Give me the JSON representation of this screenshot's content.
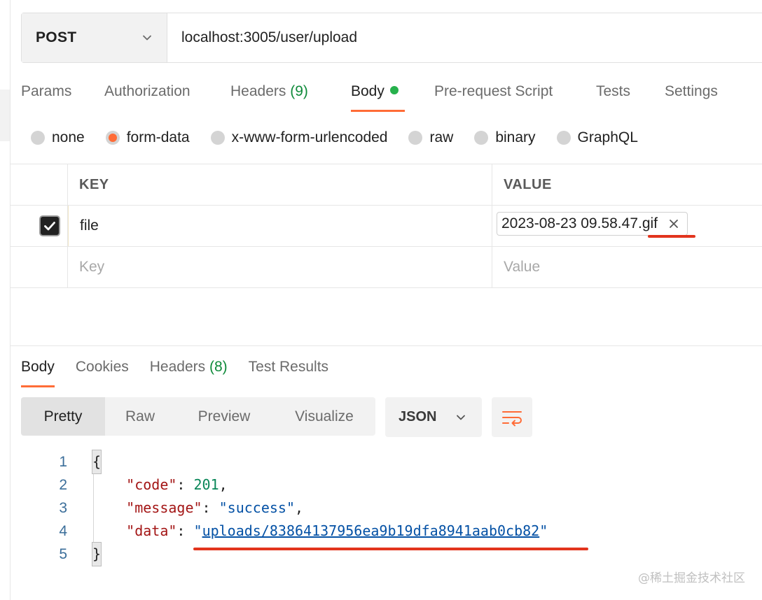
{
  "request": {
    "method": "POST",
    "url": "localhost:3005/user/upload"
  },
  "request_tabs": [
    {
      "label": "Params"
    },
    {
      "label": "Authorization"
    },
    {
      "label": "Headers",
      "count": "(9)"
    },
    {
      "label": "Body",
      "active": true
    },
    {
      "label": "Pre-request Script"
    },
    {
      "label": "Tests"
    },
    {
      "label": "Settings"
    }
  ],
  "body_types": [
    {
      "label": "none"
    },
    {
      "label": "form-data",
      "selected": true
    },
    {
      "label": "x-www-form-urlencoded"
    },
    {
      "label": "raw"
    },
    {
      "label": "binary"
    },
    {
      "label": "GraphQL"
    }
  ],
  "form_table": {
    "headers": {
      "key": "KEY",
      "value": "VALUE"
    },
    "rows": [
      {
        "checked": true,
        "key": "file",
        "value_file": "2023-08-23 09.58.47.gif"
      }
    ],
    "placeholder_key": "Key",
    "placeholder_value": "Value"
  },
  "response_tabs": [
    {
      "label": "Body",
      "active": true
    },
    {
      "label": "Cookies"
    },
    {
      "label": "Headers",
      "count": "(8)"
    },
    {
      "label": "Test Results"
    }
  ],
  "view_modes": [
    "Pretty",
    "Raw",
    "Preview",
    "Visualize"
  ],
  "view_mode_active": "Pretty",
  "format": "JSON",
  "response_body": {
    "line_numbers": [
      "1",
      "2",
      "3",
      "4",
      "5"
    ],
    "open_brace": "{",
    "close_brace": "}",
    "code_key": "\"code\"",
    "code_value": "201",
    "message_key": "\"message\"",
    "message_value": "\"success\"",
    "data_key": "\"data\"",
    "data_value": "uploads/83864137956ea9b19dfa8941aab0cb82"
  },
  "watermark": "@稀土掘金技术社区",
  "colors": {
    "accent": "#ff6c37",
    "active_dot": "#26b14c",
    "annotation_red": "#e2341d"
  }
}
